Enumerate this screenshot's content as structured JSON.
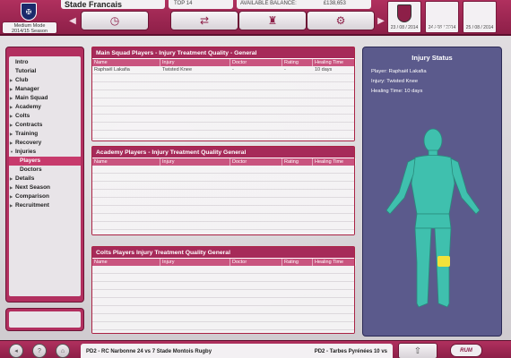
{
  "header": {
    "mode_label": "Medium Mode",
    "season_label": "2014/15 Season",
    "club_name": "Stade Francais",
    "league_position": "TOP 14",
    "balance_label": "AVAILABLE BALANCE:",
    "balance_value": "£138,653",
    "calendar_label": "Calendar",
    "dates": [
      "23 / 08 / 2014",
      "24 / 08 / 2014",
      "25 / 08 / 2014"
    ]
  },
  "sidebar": {
    "items": [
      {
        "label": "Intro",
        "arrow": false
      },
      {
        "label": "Tutorial",
        "arrow": false
      },
      {
        "label": "Club",
        "arrow": true
      },
      {
        "label": "Manager",
        "arrow": true
      },
      {
        "label": "Main Squad",
        "arrow": true
      },
      {
        "label": "Academy",
        "arrow": true
      },
      {
        "label": "Colts",
        "arrow": true
      },
      {
        "label": "Contracts",
        "arrow": true
      },
      {
        "label": "Training",
        "arrow": true
      },
      {
        "label": "Recovery",
        "arrow": true
      },
      {
        "label": "Injuries",
        "arrow": true,
        "expanded": true
      },
      {
        "label": "Players",
        "sub": true,
        "active": true
      },
      {
        "label": "Doctors",
        "sub": true
      },
      {
        "label": "Details",
        "arrow": true
      },
      {
        "label": "Next Season",
        "arrow": true
      },
      {
        "label": "Comparison",
        "arrow": true
      },
      {
        "label": "Recruitment",
        "arrow": true
      }
    ]
  },
  "panels": {
    "main": {
      "title": "Main Squad Players - Injury Treatment Quality - General",
      "columns": [
        "Name",
        "Injury",
        "Doctor",
        "Rating",
        "Healing Time"
      ],
      "rows": [
        [
          "Raphaël Lakafia",
          "Twisted Knee",
          "-",
          "-",
          "10 days"
        ]
      ]
    },
    "academy": {
      "title": "Academy Players - Injury Treatment Quality   General",
      "columns": [
        "Name",
        "Injury",
        "Doctor",
        "Rating",
        "Healing Time"
      ]
    },
    "colts": {
      "title": "Colts Players   Injury Treatment Quality   General",
      "columns": [
        "Name",
        "Injury",
        "Doctor",
        "Rating",
        "Healing Time"
      ]
    }
  },
  "injury_status": {
    "title": "Injury Status",
    "player": "Player: Raphaël Lakafia",
    "injury": "Injury: Twisted Knee",
    "healing": "Healing Time: 10 days",
    "body_color": "#3fc0ae",
    "injury_color": "#f2e23a"
  },
  "footer": {
    "ticker_left": "PD2 - RC Narbonne 24 vs 7 Stade Montois Rugby",
    "ticker_right": "PD2 - Tarbes Pyrénées 10 vs",
    "brand": "RUM"
  },
  "icons": {
    "nav": [
      "clock-icon",
      "transfer-icon",
      "trophy-icon",
      "settings-icon"
    ],
    "footer": [
      "back-icon",
      "help-icon",
      "home-icon",
      "continue-icon"
    ]
  }
}
